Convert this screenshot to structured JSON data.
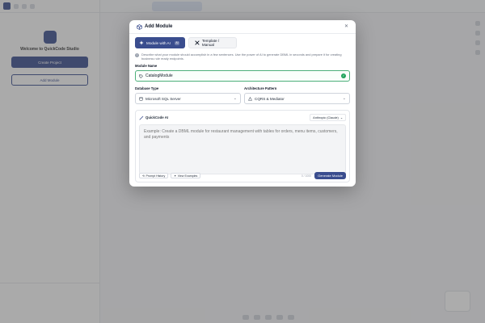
{
  "background": {
    "welcome_title": "Welcome to QuickCode Studio",
    "create_button": "Create Project",
    "add_button": "Add Module"
  },
  "modal": {
    "title": "Add Module",
    "close_icon": "close-icon",
    "tabs": [
      {
        "label": "Module with AI",
        "badge": "AI",
        "active": true
      },
      {
        "label": "Template / Manual",
        "active": false
      }
    ],
    "info_text": "Describe what your module should accomplish in a few sentences. Use the power of AI to generate DBML in seconds and prepare it for creating business rule ready endpoints.",
    "module_name": {
      "label": "Module Name",
      "value": "CatalogModule",
      "valid": true
    },
    "database_type": {
      "label": "Database Type",
      "value": "Microsoft SQL Server"
    },
    "architecture_pattern": {
      "label": "Architecture Pattern",
      "value": "CQRS & Mediator"
    },
    "quickcode_ai": {
      "title": "QuickCode AI",
      "provider": "Anthropic (Claude)",
      "placeholder": "Example: Create a DBML module for restaurant management with tables for orders, menu items, customers, and payments",
      "prompt_history": "Prompt History",
      "view_examples": "View Examples",
      "counter": "0 / 1000",
      "generate_button": "Generate Module"
    }
  },
  "colors": {
    "accent": "#3a4d8e",
    "valid": "#22a45d",
    "overlay": "rgba(70,70,70,0.45)"
  }
}
